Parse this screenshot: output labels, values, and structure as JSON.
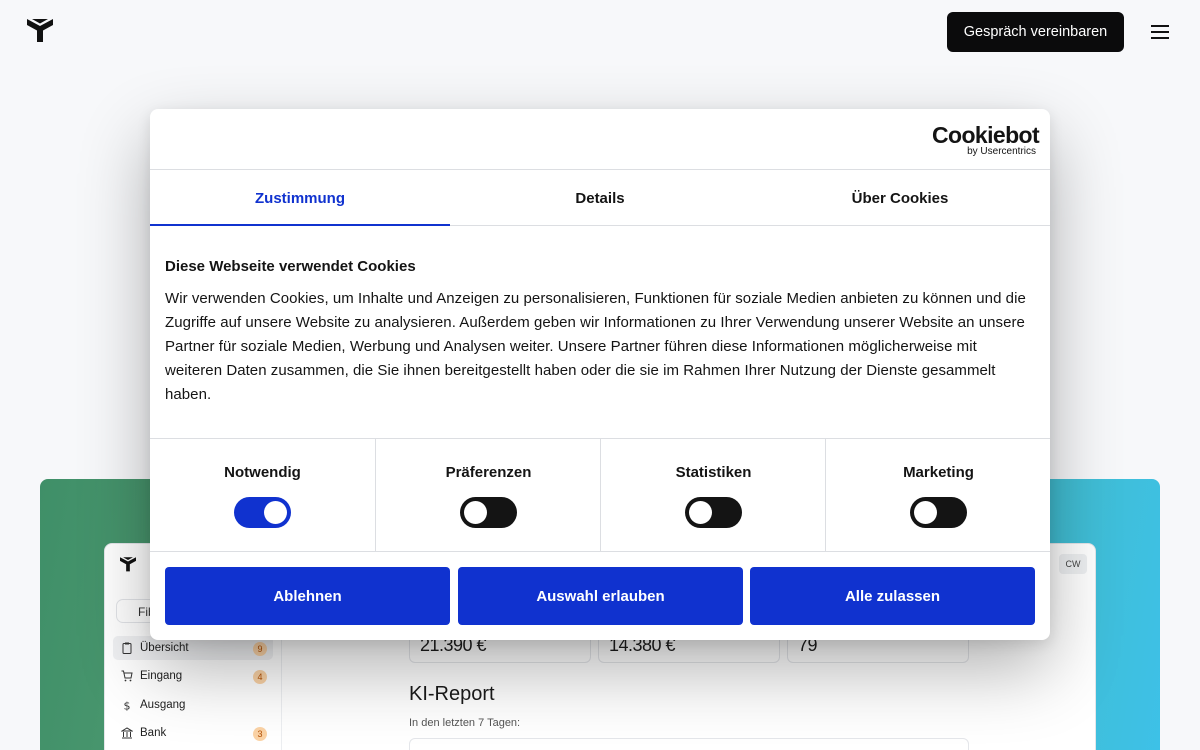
{
  "header": {
    "cta_label": "Gespräch vereinbaren"
  },
  "icons": {
    "logo": "brand-logo-icon",
    "menu": "hamburger-menu-icon"
  },
  "background_app": {
    "search_text": "Fib",
    "user_initials": "CW",
    "nav": [
      {
        "label": "Übersicht",
        "badge": "9",
        "icon": "clipboard-icon"
      },
      {
        "label": "Eingang",
        "badge": "4",
        "icon": "cart-icon"
      },
      {
        "label": "Ausgang",
        "badge": "",
        "icon": "dollar-icon"
      },
      {
        "label": "Bank",
        "badge": "3",
        "icon": "bank-icon"
      }
    ],
    "kpis": [
      "21.390 €",
      "14.380 €",
      "79"
    ],
    "report_title": "KI-Report",
    "report_subtitle": "In den letzten 7 Tagen:"
  },
  "dialog": {
    "brand_name": "Cookiebot",
    "brand_sub": "by Usercentrics",
    "tabs": [
      "Zustimmung",
      "Details",
      "Über Cookies"
    ],
    "active_tab": 0,
    "title": "Diese Webseite verwendet Cookies",
    "body": "Wir verwenden Cookies, um Inhalte und Anzeigen zu personalisieren, Funktionen für soziale Medien anbieten zu können und die Zugriffe auf unsere Website zu analysieren. Außerdem geben wir Informationen zu Ihrer Verwendung unserer Website an unsere Partner für soziale Medien, Werbung und Analysen weiter. Unsere Partner führen diese Informationen möglicherweise mit weiteren Daten zusammen, die Sie ihnen bereitgestellt haben oder die sie im Rahmen Ihrer Nutzung der Dienste gesammelt haben.",
    "categories": [
      {
        "label": "Notwendig",
        "enabled": true
      },
      {
        "label": "Präferenzen",
        "enabled": false
      },
      {
        "label": "Statistiken",
        "enabled": false
      },
      {
        "label": "Marketing",
        "enabled": false
      }
    ],
    "buttons": [
      "Ablehnen",
      "Auswahl erlauben",
      "Alle zulassen"
    ]
  },
  "colors": {
    "accent": "#1032cf",
    "cta_bg": "#0b0b0c",
    "toggle_off": "#141414"
  }
}
